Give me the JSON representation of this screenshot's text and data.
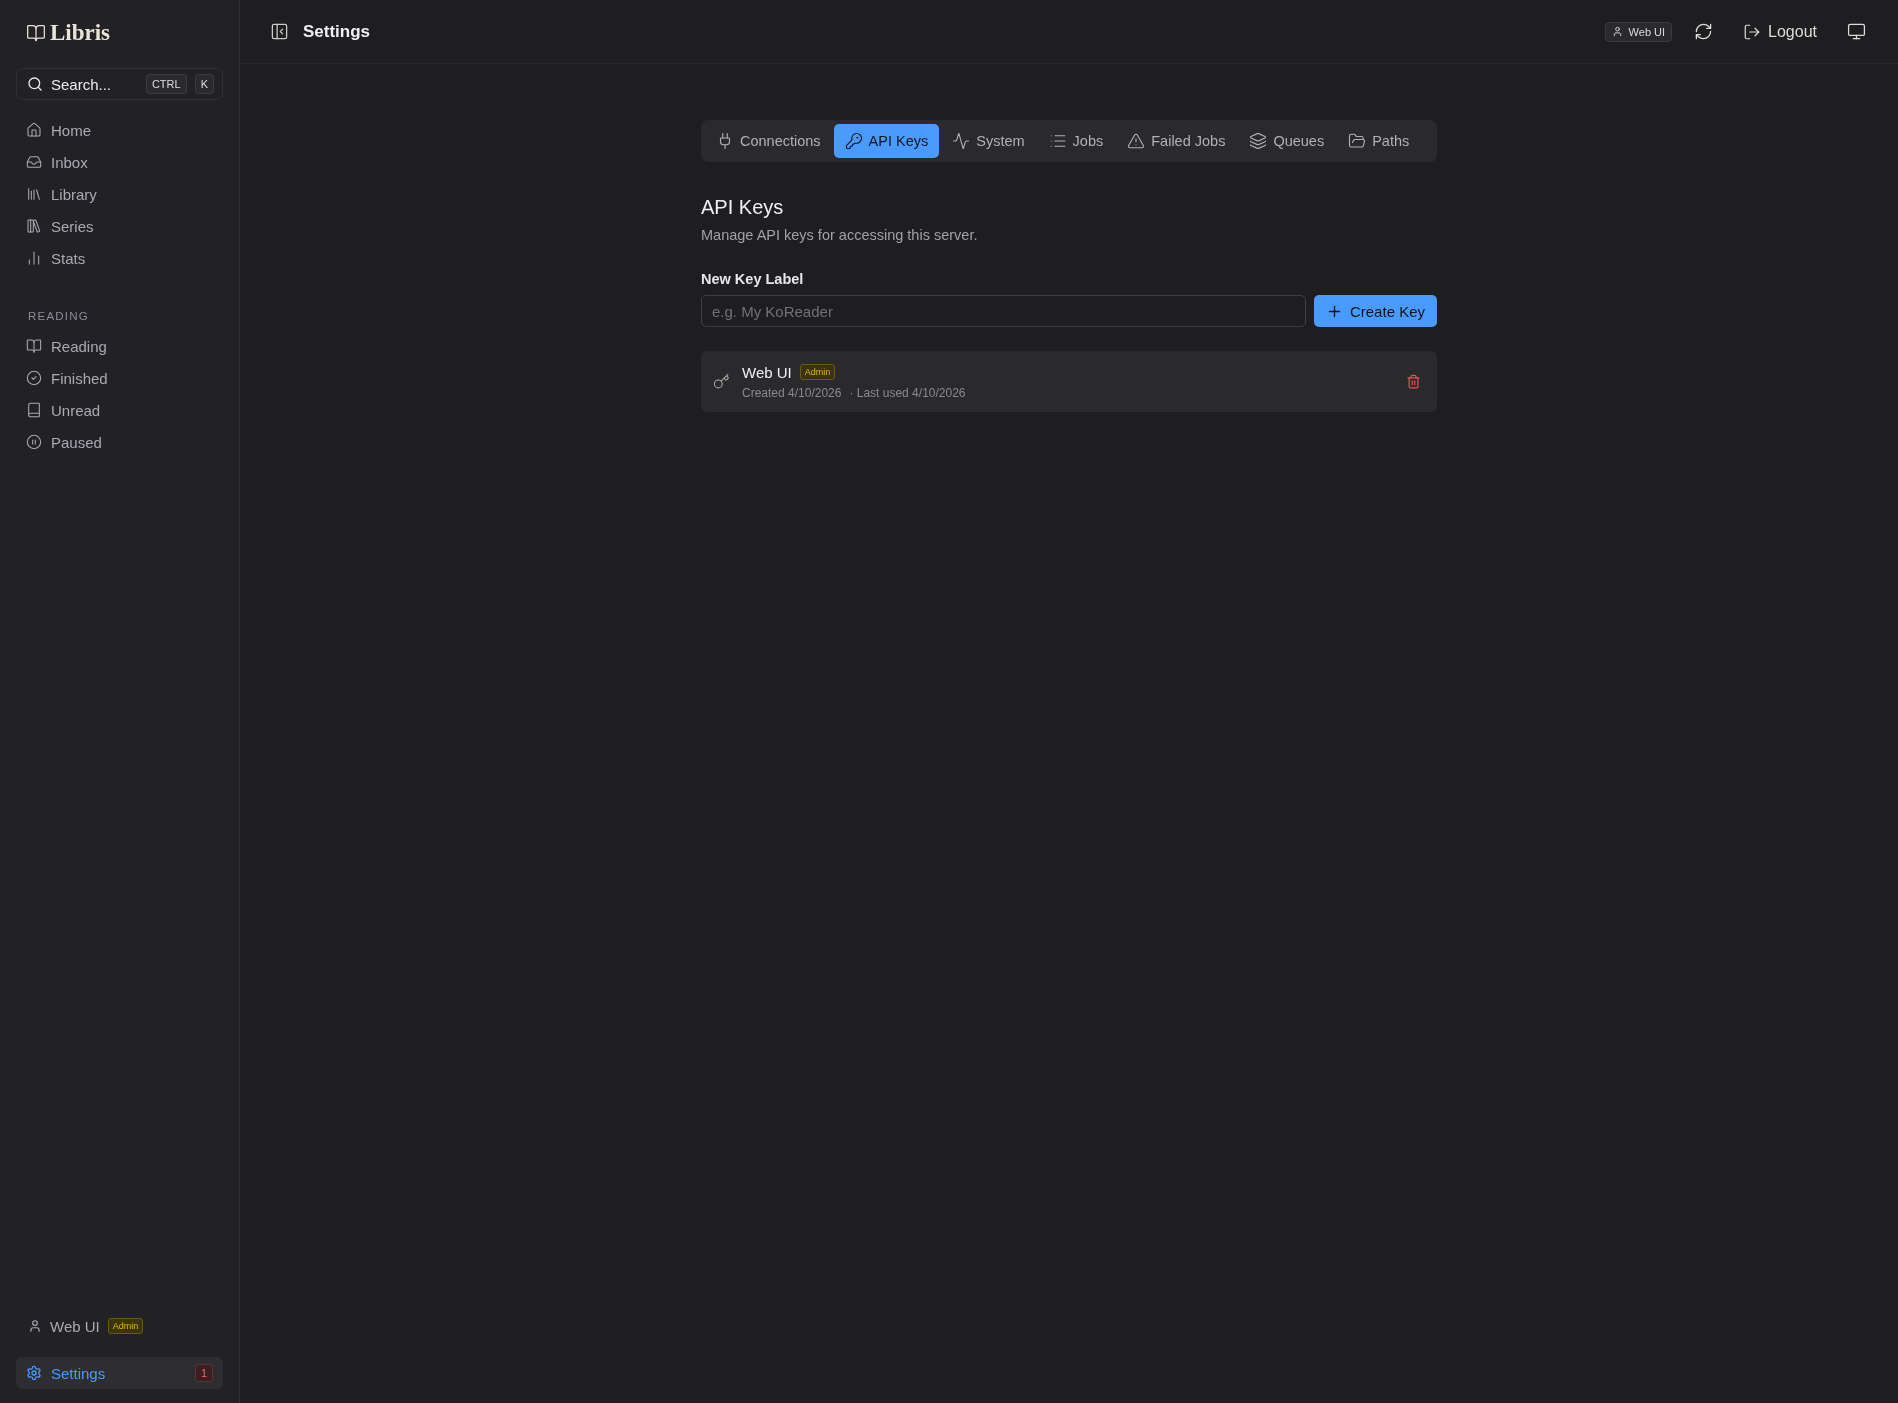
{
  "sidebar": {
    "logo": "Libris",
    "search": {
      "placeholder": "Search...",
      "keys": [
        "CTRL",
        "K"
      ]
    },
    "items": [
      {
        "label": "Home",
        "selected": false
      },
      {
        "label": "Inbox",
        "selected": false
      },
      {
        "label": "Library",
        "selected": false
      },
      {
        "label": "Series",
        "selected": false
      },
      {
        "label": "Stats",
        "selected": false
      }
    ],
    "section": "READING",
    "reading_items": [
      {
        "label": "Reading",
        "selected": false
      },
      {
        "label": "Finished",
        "selected": false
      },
      {
        "label": "Unread",
        "selected": false
      },
      {
        "label": "Paused",
        "selected": false
      }
    ],
    "user": {
      "name": "Web UI",
      "role": "Admin"
    },
    "settings": {
      "label": "Settings",
      "selected": true,
      "badge": "1"
    }
  },
  "header": {
    "title": "Settings",
    "user_chip": "Web UI",
    "logout": "Logout"
  },
  "tabs": [
    {
      "label": "Connections",
      "selected": false
    },
    {
      "label": "API Keys",
      "selected": true
    },
    {
      "label": "System",
      "selected": false
    },
    {
      "label": "Jobs",
      "selected": false
    },
    {
      "label": "Failed Jobs",
      "selected": false
    },
    {
      "label": "Queues",
      "selected": false
    },
    {
      "label": "Paths",
      "selected": false
    }
  ],
  "content": {
    "title": "API Keys",
    "description": "Manage API keys for accessing this server.",
    "field_label": "New Key Label",
    "placeholder": "e.g. My KoReader",
    "create_button": "Create Key",
    "keys": [
      {
        "name": "Web UI",
        "role": "Admin",
        "created": "Created 4/10/2026",
        "last_used": "· Last used 4/10/2026"
      }
    ]
  }
}
